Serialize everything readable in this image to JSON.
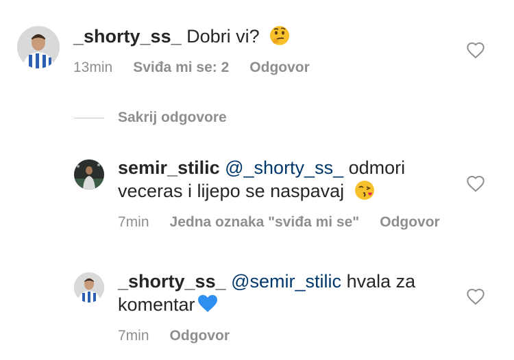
{
  "comments": [
    {
      "username": "_shorty_ss_",
      "mention": "",
      "text": "Dobri vi?",
      "text2": "",
      "emoji": "thinking-face",
      "time": "13min",
      "likes": "Sviđa mi se: 2",
      "reply": "Odgovor"
    },
    {
      "username": "semir_stilic",
      "mention": "@_shorty_ss_",
      "text": "odmori",
      "text2": "veceras i lijepo se naspavaj",
      "emoji": "face-blowing-kiss",
      "time": "7min",
      "likes": "Jedna oznaka \"sviđa mi se\"",
      "reply": "Odgovor"
    },
    {
      "username": "_shorty_ss_",
      "mention": "@semir_stilic",
      "text": "hvala za",
      "text2": "komentar",
      "emoji": "blue-heart",
      "time": "7min",
      "likes": "",
      "reply": "Odgovor"
    }
  ],
  "replies_toggle": "Sakrij odgovore",
  "icons": {
    "like": "heart-outline-icon"
  },
  "colors": {
    "mention": "#00376b",
    "meta": "#8e8e8e",
    "text": "#262626"
  }
}
